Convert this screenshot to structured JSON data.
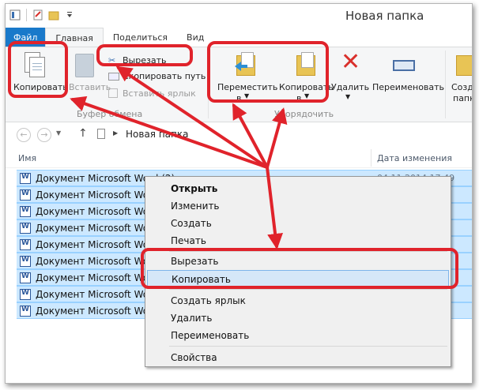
{
  "window": {
    "title": "Новая папка"
  },
  "tabs": [
    {
      "label": "Файл"
    },
    {
      "label": "Главная"
    },
    {
      "label": "Поделиться"
    },
    {
      "label": "Вид"
    }
  ],
  "ribbon": {
    "copy": "Копировать",
    "paste": "Вставить",
    "cut": "Вырезать",
    "copy_path": "Скопировать путь",
    "paste_shortcut": "Вставить ярлык",
    "clipboard_group": "Буфер обмена",
    "move_to_1": "Переместить",
    "move_to_2": "в",
    "copy_to_1": "Копировать",
    "copy_to_2": "в",
    "delete": "Удалить",
    "rename": "Переименовать",
    "organize_group": "Упорядочить",
    "create_1": "Созд",
    "create_2": "папк"
  },
  "address": {
    "path": "Новая папка"
  },
  "columns": {
    "name": "Имя",
    "date": "Дата изменения"
  },
  "files": [
    {
      "name": "Документ Microsoft Word (2)",
      "date": "04.11.2014 17:49"
    },
    {
      "name": "Документ Microsoft Word",
      "date": ""
    },
    {
      "name": "Документ Microsoft Word",
      "date": ""
    },
    {
      "name": "Документ Microsoft Word",
      "date": ""
    },
    {
      "name": "Документ Microsoft Word",
      "date": ""
    },
    {
      "name": "Документ Microsoft Word",
      "date": ""
    },
    {
      "name": "Документ Microsoft Word",
      "date": ""
    },
    {
      "name": "Документ Microsoft Word",
      "date": ""
    },
    {
      "name": "Документ Microsoft Word",
      "date": ""
    }
  ],
  "context_menu": {
    "open": "Открыть",
    "edit": "Изменить",
    "create": "Создать",
    "print": "Печать",
    "cut": "Вырезать",
    "copy": "Копировать",
    "create_shortcut": "Создать ярлык",
    "delete": "Удалить",
    "rename": "Переименовать",
    "properties": "Свойства"
  },
  "colors": {
    "file_tab": "#1979ca",
    "selection": "#cce8ff",
    "annotation": "#e0232b"
  }
}
